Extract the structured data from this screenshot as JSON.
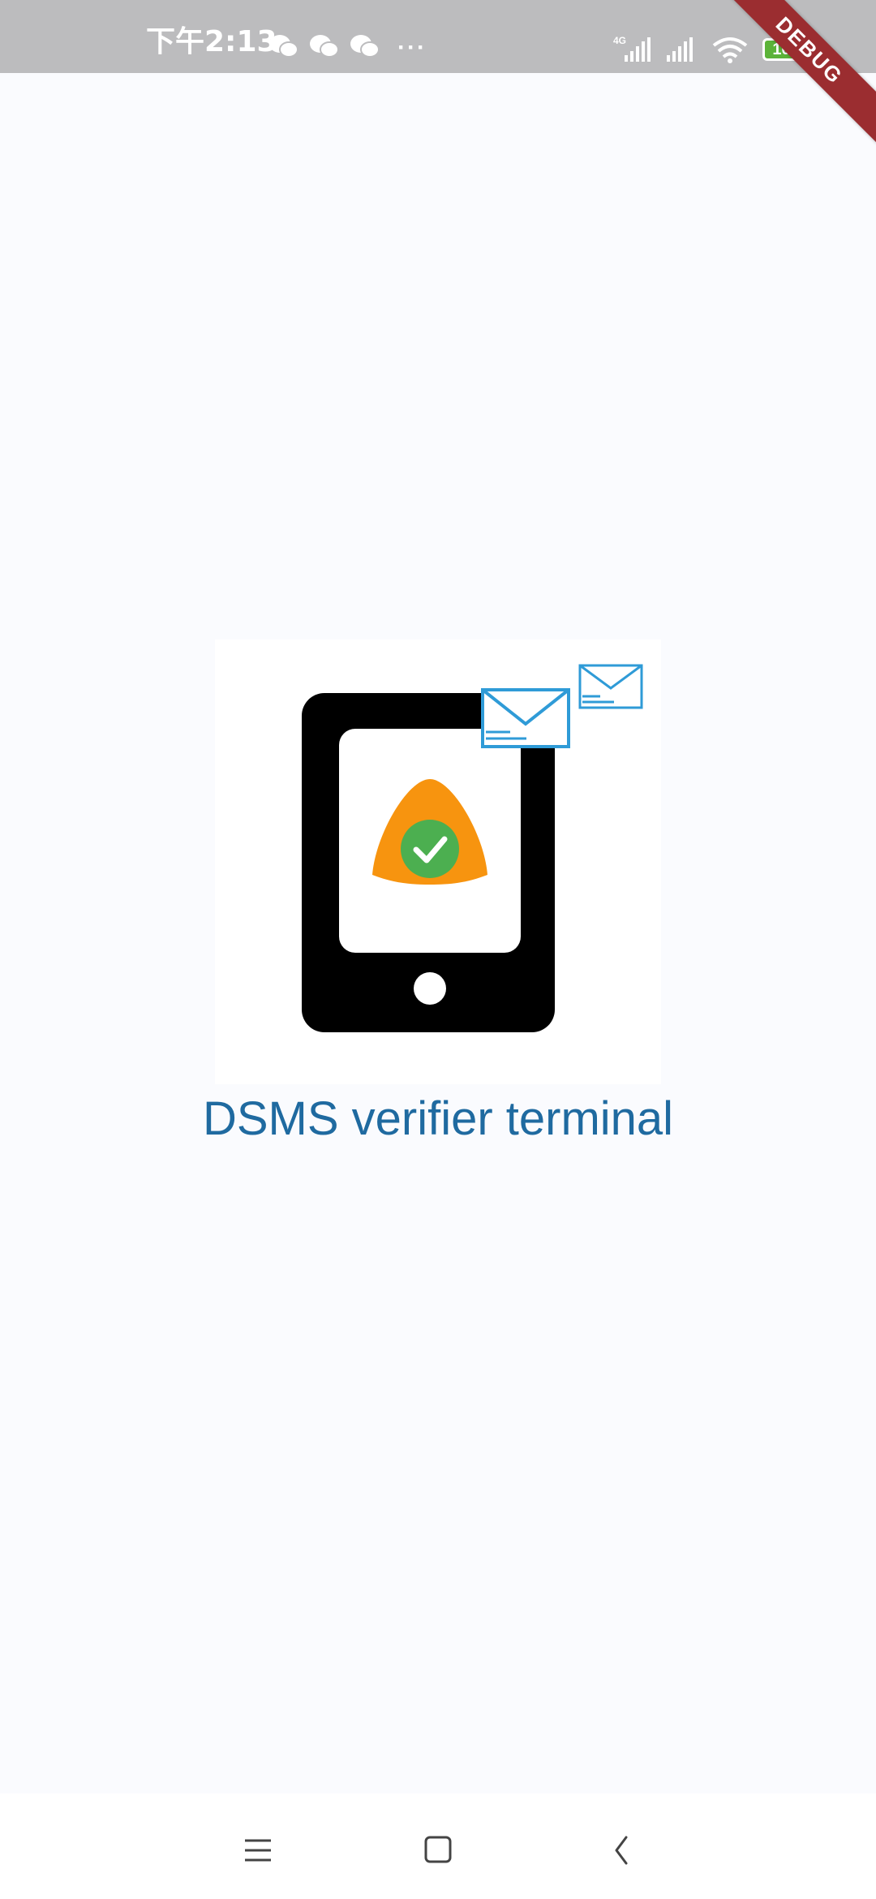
{
  "status_bar": {
    "time": "下午2:13",
    "more_dots": "···",
    "network_type": "4G",
    "battery_level": "100",
    "icons": [
      "wechat-icon",
      "wechat-icon",
      "wechat-icon",
      "signal-icon",
      "signal-icon",
      "wifi-icon",
      "battery-icon"
    ]
  },
  "debug_banner": "DEBUG",
  "app": {
    "title": "DSMS verifier terminal",
    "logo": "phone-shield-mail-logo"
  },
  "nav": {
    "menu": "menu-icon",
    "home": "home-icon",
    "back": "back-icon"
  },
  "colors": {
    "background": "#fafbfe",
    "title": "#1f6aa0",
    "shield": "#f7940f",
    "check_circle": "#4caf50",
    "mail": "#2f9bd7",
    "debug": "#9b2d30"
  }
}
